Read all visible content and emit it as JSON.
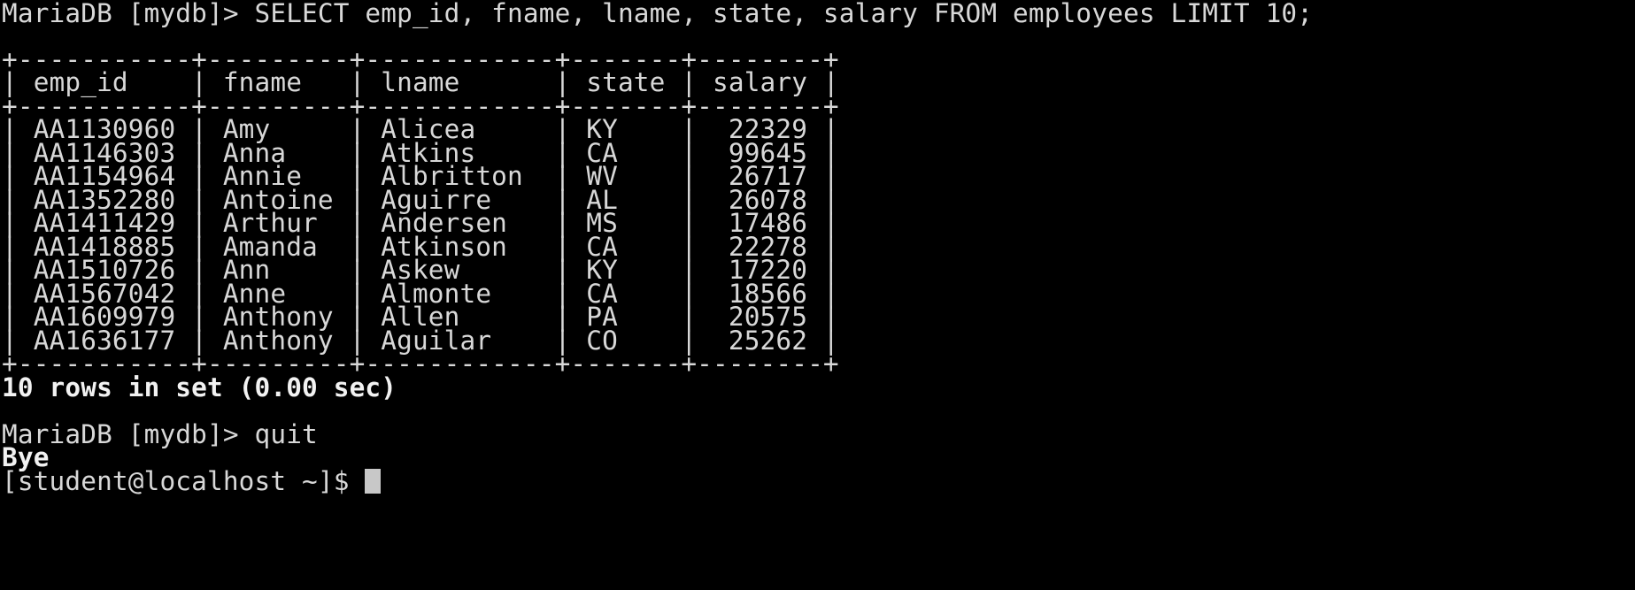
{
  "terminal": {
    "query_line": "MariaDB [mydb]> SELECT emp_id, fname, lname, state, salary FROM employees LIMIT 10;",
    "table": {
      "border": "+-----------+---------+------------+-------+--------+",
      "header": "| emp_id    | fname   | lname      | state | salary |",
      "rows": [
        "| AA1130960 | Amy     | Alicea     | KY    |  22329 |",
        "| AA1146303 | Anna    | Atkins     | CA    |  99645 |",
        "| AA1154964 | Annie   | Albritton  | WV    |  26717 |",
        "| AA1352280 | Antoine | Aguirre    | AL    |  26078 |",
        "| AA1411429 | Arthur  | Andersen   | MS    |  17486 |",
        "| AA1418885 | Amanda  | Atkinson   | CA    |  22278 |",
        "| AA1510726 | Ann     | Askew      | KY    |  17220 |",
        "| AA1567042 | Anne    | Almonte    | CA    |  18566 |",
        "| AA1609979 | Anthony | Allen      | PA    |  20575 |",
        "| AA1636177 | Anthony | Aguilar    | CO    |  25262 |"
      ]
    },
    "result_summary": "10 rows in set (0.00 sec)",
    "quit_line": "MariaDB [mydb]> quit",
    "bye_line": "Bye",
    "shell_prompt": "[student@localhost ~]$ "
  }
}
